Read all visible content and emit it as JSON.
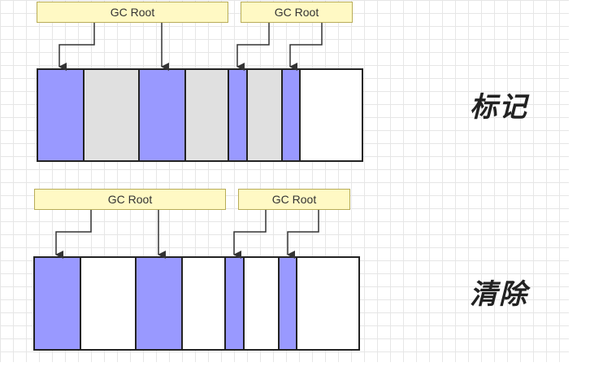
{
  "diagram": {
    "colors": {
      "reachable": "#9999ff",
      "unreachable": "#e0e0e0",
      "free": "#ffffff",
      "border": "#222222",
      "label_bg": "#fff9c4"
    },
    "mark_phase": {
      "title": "标记",
      "roots": [
        {
          "label": "GC Root"
        },
        {
          "label": "GC Root"
        }
      ],
      "blocks": [
        "reachable",
        "unreachable",
        "reachable",
        "unreachable",
        "reachable",
        "unreachable",
        "reachable",
        "free"
      ]
    },
    "sweep_phase": {
      "title": "清除",
      "roots": [
        {
          "label": "GC Root"
        },
        {
          "label": "GC Root"
        }
      ],
      "blocks": [
        "reachable",
        "free",
        "reachable",
        "free",
        "reachable",
        "free",
        "reachable",
        "free"
      ]
    }
  }
}
